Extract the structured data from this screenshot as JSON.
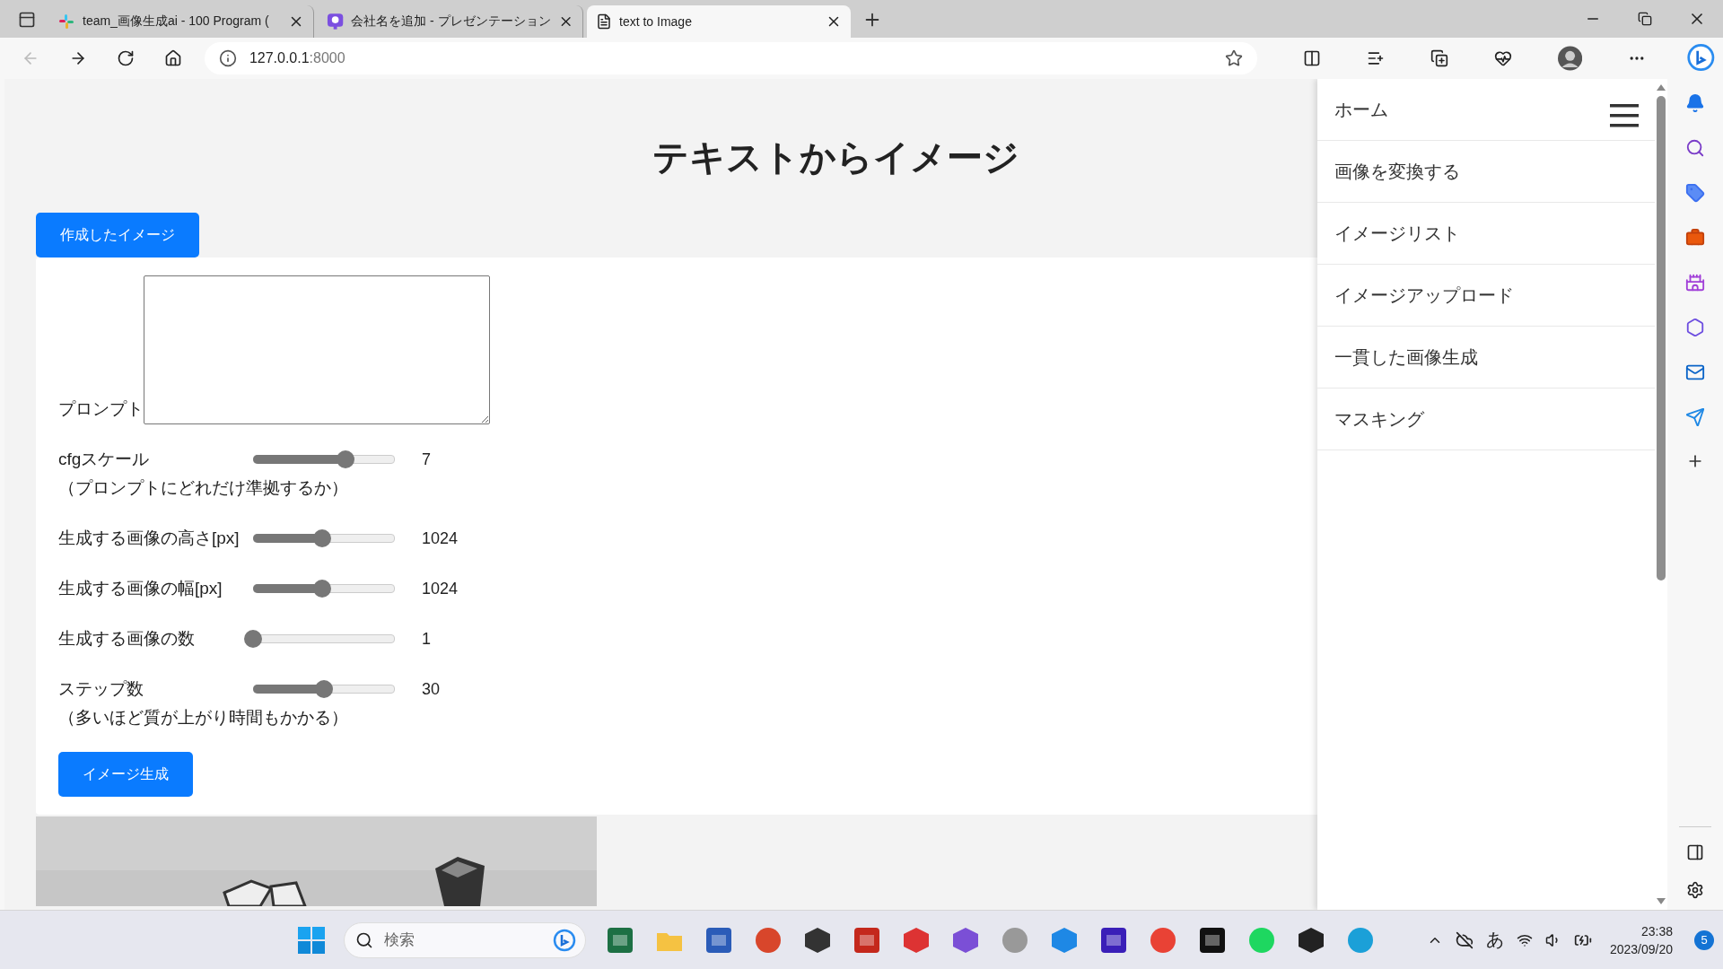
{
  "browser_tabs": [
    {
      "title": "team_画像生成ai - 100 Program (",
      "selected": false,
      "kind": "chat"
    },
    {
      "title": "会社名を追加 - プレゼンテーション",
      "selected": false,
      "kind": "slides"
    },
    {
      "title": "text to Image",
      "selected": true,
      "kind": "page"
    }
  ],
  "address_bar": {
    "host": "127.0.0.1",
    "port": ":8000"
  },
  "page": {
    "title": "テキストからイメージ",
    "created_images_button": "作成したイメージ",
    "prompt_label": "プロンプト",
    "sliders": [
      {
        "label": "cfgスケール",
        "note": "（プロンプトにどれだけ準拠するか）",
        "level": 0.65,
        "value": "7"
      },
      {
        "label": "生成する画像の高さ[px]",
        "level": 0.49,
        "value": "1024"
      },
      {
        "label": "生成する画像の幅[px]",
        "level": 0.49,
        "value": "1024"
      },
      {
        "label": "生成する画像の数",
        "level": 0,
        "value": "1"
      },
      {
        "label": "ステップ数",
        "note": "（多いほど質が上がり時間もかかる）",
        "level": 0.5,
        "value": "30"
      }
    ],
    "generate_button": "イメージ生成"
  },
  "nav_drawer": {
    "items": [
      "ホーム",
      "画像を変換する",
      "イメージリスト",
      "イメージアップロード",
      "一貫した画像生成",
      "マスキング"
    ]
  },
  "taskbar": {
    "search_placeholder": "検索",
    "ime": "あ",
    "time": "23:38",
    "date": "2023/09/20",
    "notifications": "5"
  }
}
